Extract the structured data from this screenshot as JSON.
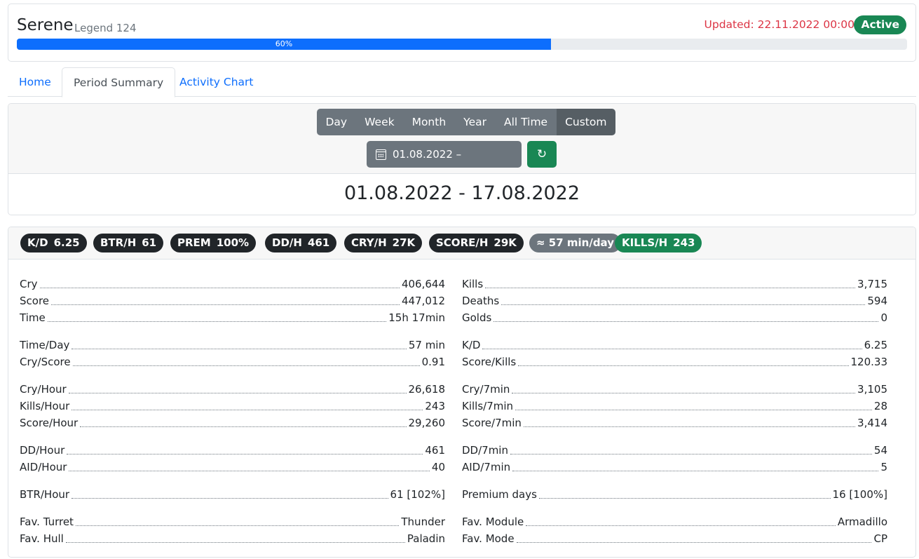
{
  "header": {
    "player_name": "Serene",
    "rank": "Legend 124",
    "updated": "Updated: 22.11.2022 00:00",
    "status": "Active",
    "progress_label": "60%",
    "progress_value": 0.6
  },
  "tabs": [
    {
      "label": "Home"
    },
    {
      "label": "Period Summary"
    },
    {
      "label": "Activity Chart"
    }
  ],
  "period": {
    "buttons": [
      "Day",
      "Week",
      "Month",
      "Year",
      "All Time",
      "Custom"
    ],
    "active_button": "Custom",
    "date_range": "01.08.2022 – 17.08.2022",
    "title": "01.08.2022 - 17.08.2022"
  },
  "badges": [
    {
      "label": "K/D",
      "value": "6.25"
    },
    {
      "label": "BTR/H",
      "value": "61"
    },
    {
      "label": "PREM",
      "value": "100%"
    },
    {
      "label": "DD/H",
      "value": "461"
    },
    {
      "label": "CRY/H",
      "value": "27K"
    },
    {
      "label": "SCORE/H",
      "value": "29K"
    },
    {
      "label": "≈ 57 min/day",
      "value": ""
    },
    {
      "label": "KILLS/H",
      "value": "243"
    }
  ],
  "stats_left": [
    {
      "label": "Cry",
      "value": "406,644"
    },
    {
      "label": "Score",
      "value": "447,012"
    },
    {
      "label": "Time",
      "value": "15h 17min"
    },
    {
      "label": "Time/Day",
      "value": "57 min"
    },
    {
      "label": "Cry/Score",
      "value": "0.91"
    },
    {
      "label": "Cry/Hour",
      "value": "26,618"
    },
    {
      "label": "Kills/Hour",
      "value": "243"
    },
    {
      "label": "Score/Hour",
      "value": "29,260"
    },
    {
      "label": "DD/Hour",
      "value": "461"
    },
    {
      "label": "AID/Hour",
      "value": "40"
    },
    {
      "label": "BTR/Hour",
      "value": "61 [102%]"
    },
    {
      "label": "Fav. Turret",
      "value": "Thunder"
    },
    {
      "label": "Fav. Hull",
      "value": "Paladin"
    }
  ],
  "stats_right": [
    {
      "label": "Kills",
      "value": "3,715"
    },
    {
      "label": "Deaths",
      "value": "594"
    },
    {
      "label": "Golds",
      "value": "0"
    },
    {
      "label": "K/D",
      "value": "6.25"
    },
    {
      "label": "Score/Kills",
      "value": "120.33"
    },
    {
      "label": "Cry/7min",
      "value": "3,105"
    },
    {
      "label": "Kills/7min",
      "value": "28"
    },
    {
      "label": "Score/7min",
      "value": "3,414"
    },
    {
      "label": "DD/7min",
      "value": "54"
    },
    {
      "label": "AID/7min",
      "value": "5"
    },
    {
      "label": "Premium days",
      "value": "16 [100%]"
    },
    {
      "label": "Fav. Module",
      "value": "Armadillo"
    },
    {
      "label": "Fav. Mode",
      "value": "CP"
    }
  ]
}
